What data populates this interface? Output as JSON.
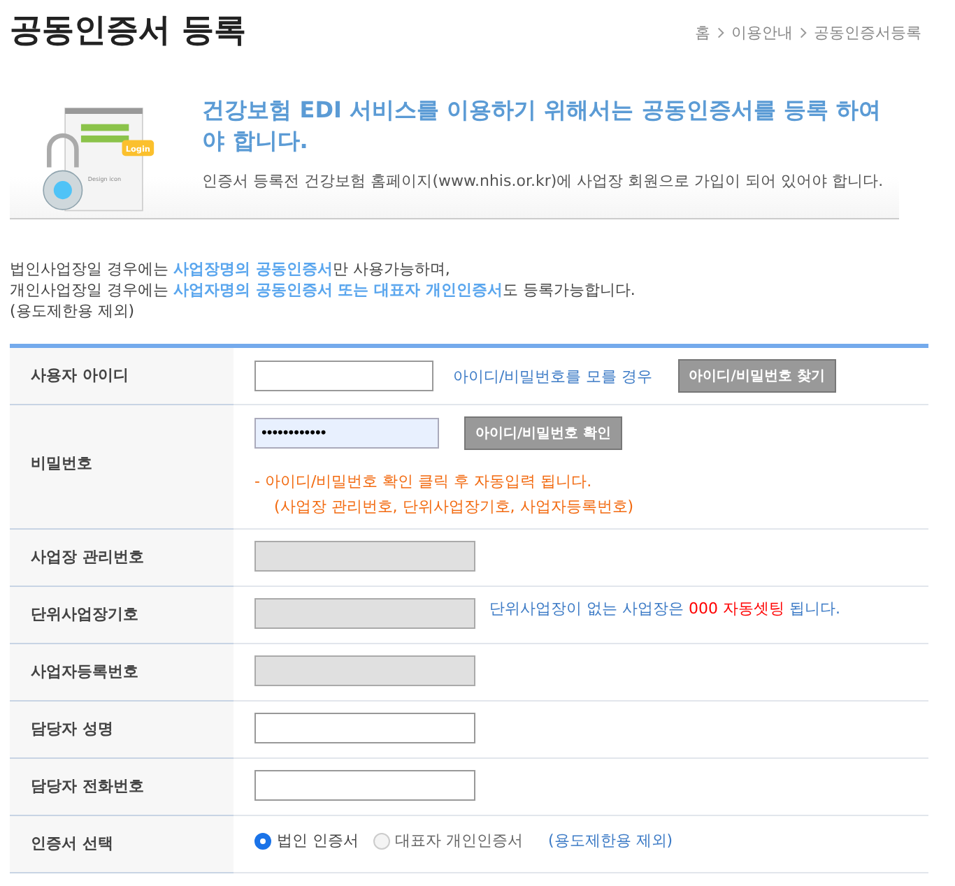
{
  "page_title": "공동인증서 등록",
  "breadcrumb": [
    "홈",
    "이용안내",
    "공동인증서등록"
  ],
  "banner": {
    "illustration": {
      "badge": "Login",
      "caption": "Design icon"
    },
    "headline": "건강보험 EDI 서비스를 이용하기 위해서는 공동인증서를 등록 하여야 합니다.",
    "subtext": "인증서 등록전 건강보험 홈페이지(www.nhis.or.kr)에 사업장 회원으로 가입이 되어 있어야 합니다."
  },
  "notice": [
    "법인사업장일 경우에는 **사업장명의 공동인증서**만 사용가능하며,",
    "개인사업장일 경우에는 **사업자명의 공동인증서 또는 대표자 개인인증서**도 등록가능합니다.",
    "(용도제한용 제외)"
  ],
  "form": {
    "rows": [
      {
        "kind": "id",
        "label": "사용자 아이디",
        "hint": "아이디/비밀번호를 모를 경우",
        "button": "아이디/비밀번호 찾기"
      },
      {
        "kind": "password",
        "label": "비밀번호",
        "value": "••••••••••••",
        "button": "아이디/비밀번호 확인",
        "notes": [
          "- 아이디/비밀번호 확인 클릭 후 자동입력 됩니다.",
          "(사업장 관리번호, 단위사업장기호, 사업자등록번호)"
        ]
      },
      {
        "kind": "input",
        "label": "사업장 관리번호",
        "disabled": true
      },
      {
        "kind": "input",
        "label": "단위사업장기호",
        "disabled": true,
        "note": "단위사업장이 없는 사업장은 **000 자동셋팅** 됩니다."
      },
      {
        "kind": "input",
        "label": "사업자등록번호",
        "disabled": true
      },
      {
        "kind": "input",
        "label": "담당자 성명",
        "disabled": false
      },
      {
        "kind": "input",
        "label": "담당자 전화번호",
        "disabled": false
      },
      {
        "kind": "radio",
        "label": "인증서 선택",
        "options": [
          {
            "label": "법인 인증서",
            "selected": true
          },
          {
            "label": "대표자 개인인증서",
            "selected": false
          }
        ],
        "note": "(용도제한용 제외)"
      }
    ]
  }
}
